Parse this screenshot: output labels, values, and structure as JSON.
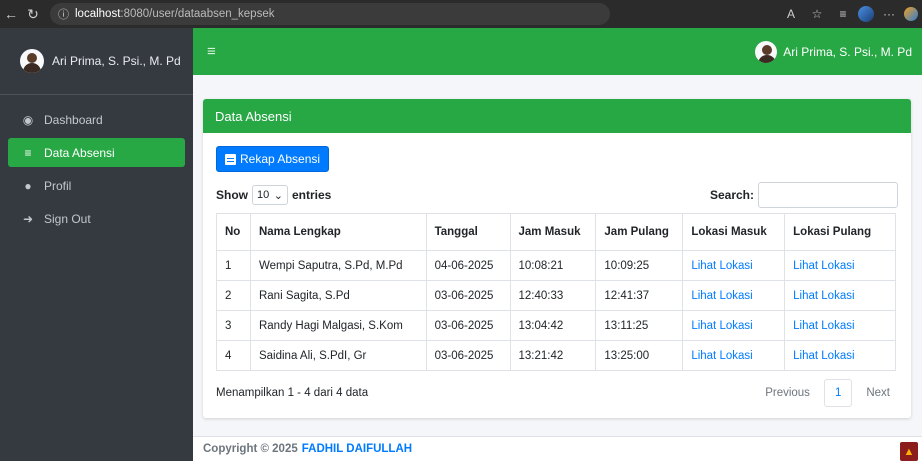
{
  "browser": {
    "url_host": "localhost",
    "url_rest": ":8080/user/dataabsen_kepsek",
    "back_icon": "←",
    "refresh_icon": "↻",
    "info_icon": "ⓘ",
    "reader_icon": "A",
    "star_icon": "☆",
    "favorites_icon": "≡",
    "more_icon": "···"
  },
  "sidebar": {
    "user_name": "Ari Prima, S. Psi., M. Pd",
    "items": [
      {
        "label": "Dashboard",
        "icon": "dashboard-icon",
        "glyph": "◉"
      },
      {
        "label": "Data Absensi",
        "icon": "database-icon",
        "glyph": "≡"
      },
      {
        "label": "Profil",
        "icon": "user-icon",
        "glyph": "●"
      },
      {
        "label": "Sign Out",
        "icon": "sign-out-icon",
        "glyph": "➜"
      }
    ]
  },
  "header": {
    "menu_glyph": "≡",
    "user_name": "Ari Prima, S. Psi., M. Pd"
  },
  "card": {
    "title": "Data Absensi",
    "rekap_label": "Rekap Absensi",
    "show_label": "Show",
    "entries_label": "entries",
    "page_length": "10",
    "search_label": "Search:",
    "search_value": "",
    "columns": [
      "No",
      "Nama Lengkap",
      "Tanggal",
      "Jam Masuk",
      "Jam Pulang",
      "Lokasi Masuk",
      "Lokasi Pulang"
    ],
    "rows": [
      [
        "1",
        "Wempi Saputra, S.Pd, M.Pd",
        "04-06-2025",
        "10:08:21",
        "10:09:25",
        "Lihat Lokasi",
        "Lihat Lokasi"
      ],
      [
        "2",
        "Rani Sagita, S.Pd",
        "03-06-2025",
        "12:40:33",
        "12:41:37",
        "Lihat Lokasi",
        "Lihat Lokasi"
      ],
      [
        "3",
        "Randy Hagi Malgasi, S.Kom",
        "03-06-2025",
        "13:04:42",
        "13:11:25",
        "Lihat Lokasi",
        "Lihat Lokasi"
      ],
      [
        "4",
        "Saidina Ali, S.PdI, Gr",
        "03-06-2025",
        "13:21:42",
        "13:25:00",
        "Lihat Lokasi",
        "Lihat Lokasi"
      ]
    ],
    "info": "Menampilkan 1 - 4 dari 4 data",
    "prev_label": "Previous",
    "current_page": "1",
    "next_label": "Next"
  },
  "footer": {
    "copyright": "Copyright © 2025",
    "brand": "FADHIL DAIFULLAH"
  },
  "colors": {
    "accent_green": "#28a745",
    "primary_blue": "#007bff",
    "sidebar_dark": "#343a40"
  }
}
